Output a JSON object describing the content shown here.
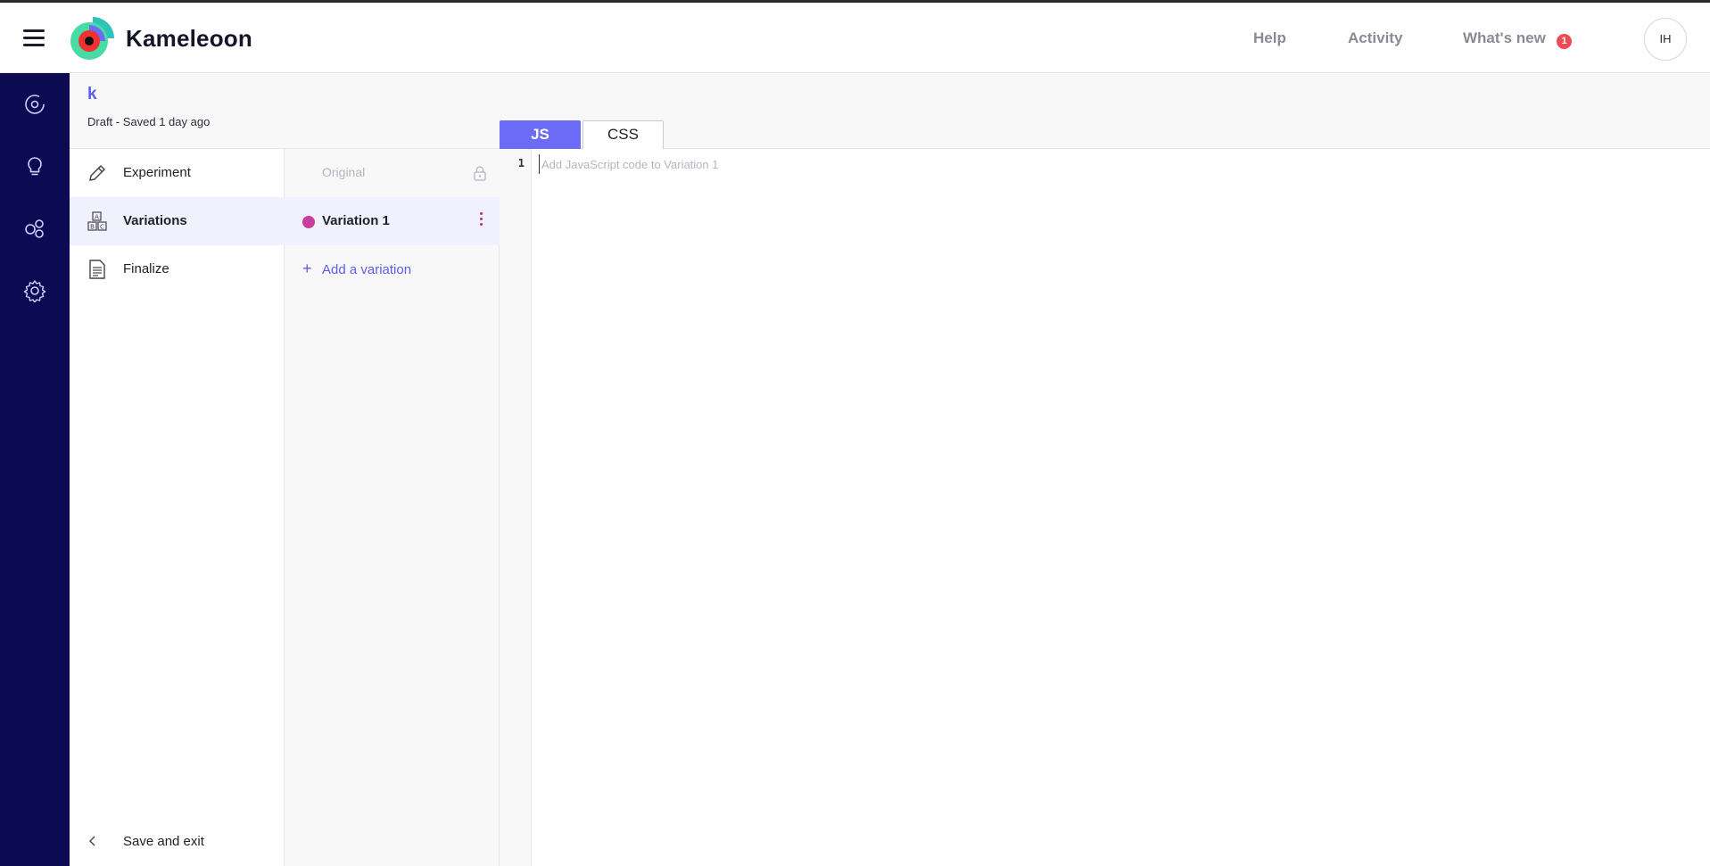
{
  "header": {
    "brand": "Kameleoon",
    "nav": {
      "help": "Help",
      "activity": "Activity",
      "whats_new": "What's new",
      "whats_new_count": "1"
    },
    "user_initials": "IH"
  },
  "rail": {
    "icons": [
      "target-icon",
      "lightbulb-icon",
      "segments-icon",
      "gear-icon"
    ]
  },
  "experiment": {
    "name": "k",
    "status": "Draft - Saved 1 day ago"
  },
  "steps": {
    "experiment": "Experiment",
    "variations": "Variations",
    "finalize": "Finalize",
    "save_exit": "Save and exit",
    "active": "Variations"
  },
  "variations": {
    "original": "Original",
    "items": [
      {
        "name": "Variation 1",
        "color": "#c73e9c"
      }
    ],
    "add_label": "Add a variation"
  },
  "editor": {
    "tabs": {
      "js": "JS",
      "css": "CSS",
      "active": "JS"
    },
    "line_number": "1",
    "placeholder": "Add JavaScript code to Variation 1",
    "value": ""
  },
  "colors": {
    "rail": "#0c0a52",
    "accent": "#6c6bf8",
    "variation_dot": "#c73e9c",
    "badge": "#f04b55"
  }
}
